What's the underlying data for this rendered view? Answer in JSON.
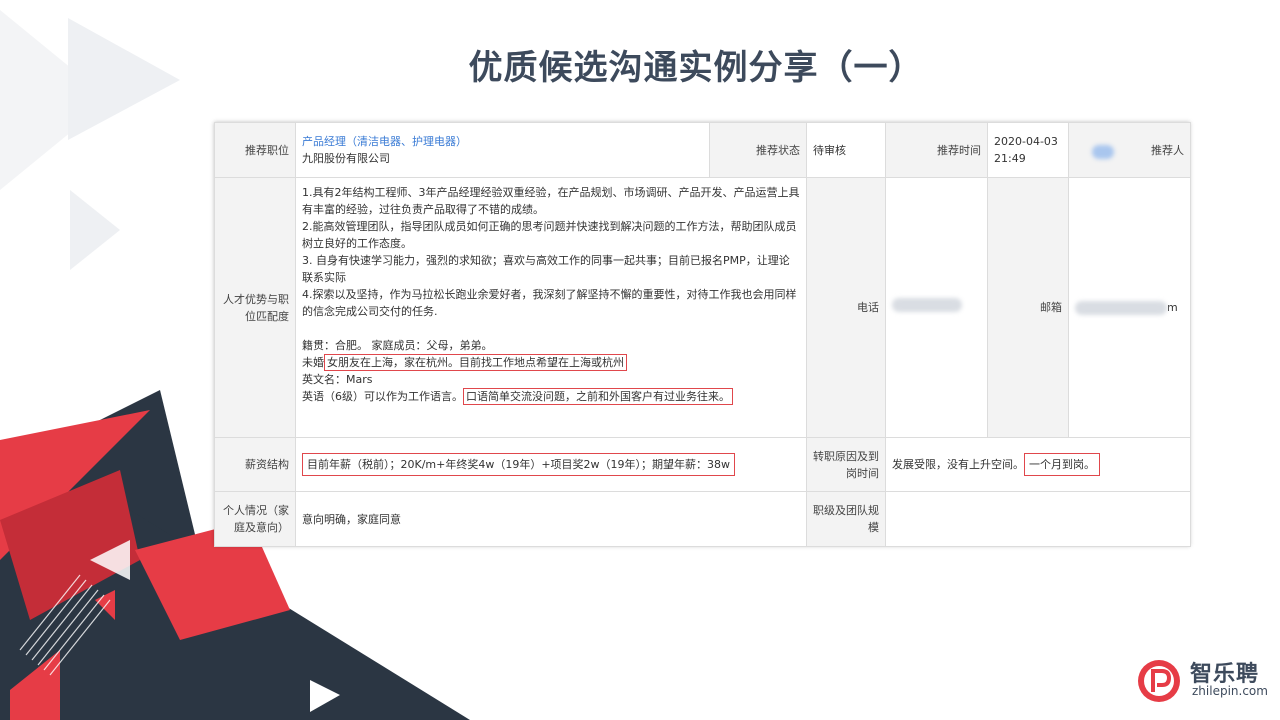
{
  "title": "优质候选沟通实例分享（一）",
  "colors": {
    "accent": "#e63c46",
    "dark": "#2b3643",
    "title": "#3d4a5c",
    "highlight_border": "#e0474c",
    "link": "#3a7bd5"
  },
  "table": {
    "row1": {
      "position_label": "推荐职位",
      "position_title": "产品经理（清洁电器、护理电器）",
      "company": "九阳股份有限公司",
      "status_label": "推荐状态",
      "status_value": "待审核",
      "time_label": "推荐时间",
      "time_date": "2020-04-03",
      "time_clock": "21:49",
      "recommender_label": "推荐人"
    },
    "row2": {
      "label": "人才优势与职位匹配度",
      "points": [
        "1.具有2年结构工程师、3年产品经理经验双重经验，在产品规划、市场调研、产品开发、产品运营上具有丰富的经验，过往负责产品取得了不错的成绩。",
        "2.能高效管理团队，指导团队成员如何正确的思考问题并快速找到解决问题的工作方法，帮助团队成员树立良好的工作态度。",
        "3. 自身有快速学习能力，强烈的求知欲；喜欢与高效工作的同事一起共事；目前已报名PMP，让理论联系实际",
        "4.探索以及坚持，作为马拉松长跑业余爱好者，我深刻了解坚持不懈的重要性，对待工作我也会用同样的信念完成公司交付的任务."
      ],
      "native_place": "籍贯：合肥。 家庭成员：父母，弟弟。",
      "marital_prefix": "未婚",
      "marital_highlight": "女朋友在上海，家在杭州。目前找工作地点希望在上海或杭州",
      "english_name": "英文名：Mars",
      "english_prefix": "英语（6级）可以作为工作语言。",
      "english_highlight": "口语简单交流没问题，之前和外国客户有过业务往来。",
      "phone_label": "电话",
      "email_label": "邮箱",
      "email_suffix": "m"
    },
    "row3": {
      "label": "薪资结构",
      "salary": "目前年薪（税前）；20K/m+年终奖4w（19年）+项目奖2w（19年）；期望年薪：38w",
      "reason_label": "转职原因及到岗时间",
      "reason_prefix": "发展受限，没有上升空间。",
      "reason_highlight": "一个月到岗。"
    },
    "row4": {
      "label": "个人情况（家庭及意向）",
      "value": "意向明确，家庭同意",
      "team_label": "职级及团队规模",
      "team_value": ""
    }
  },
  "logo": {
    "cn": "智乐聘",
    "en": "zhilepin.com"
  }
}
